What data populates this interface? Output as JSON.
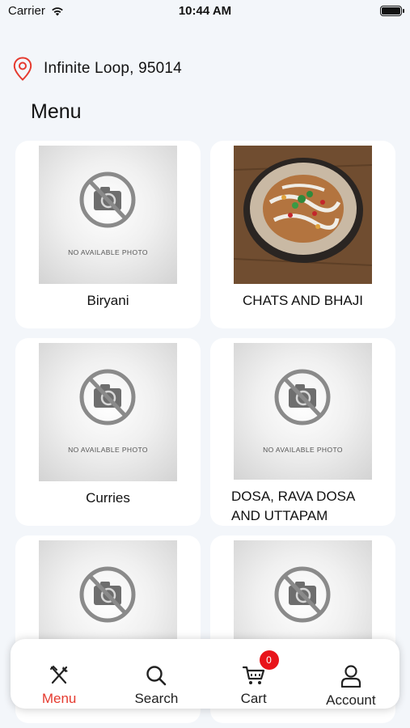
{
  "status_bar": {
    "carrier": "Carrier",
    "time": "10:44 AM",
    "battery_level": 1.0
  },
  "location": {
    "address": "Infinite Loop, 95014"
  },
  "page": {
    "title": "Menu"
  },
  "placeholder": {
    "text": "NO AVAILABLE PHOTO"
  },
  "menu_items": [
    {
      "name": "Biryani",
      "image": "placeholder"
    },
    {
      "name": "CHATS AND BHAJI",
      "image": "food-photo"
    },
    {
      "name": "Curries",
      "image": "placeholder"
    },
    {
      "name": "DOSA, RAVA DOSA AND UTTAPAM",
      "image": "placeholder"
    },
    {
      "name": "",
      "image": "placeholder"
    },
    {
      "name": "",
      "image": "placeholder"
    }
  ],
  "tab_bar": {
    "tabs": [
      {
        "label": "Menu",
        "icon": "utensils-icon",
        "active": true
      },
      {
        "label": "Search",
        "icon": "search-icon",
        "active": false
      },
      {
        "label": "Cart",
        "icon": "cart-icon",
        "active": false,
        "badge": "0"
      },
      {
        "label": "Account",
        "icon": "user-icon",
        "active": false
      }
    ]
  },
  "colors": {
    "accent": "#e53a2f",
    "badge": "#e8141a",
    "background": "#f3f6fa"
  }
}
